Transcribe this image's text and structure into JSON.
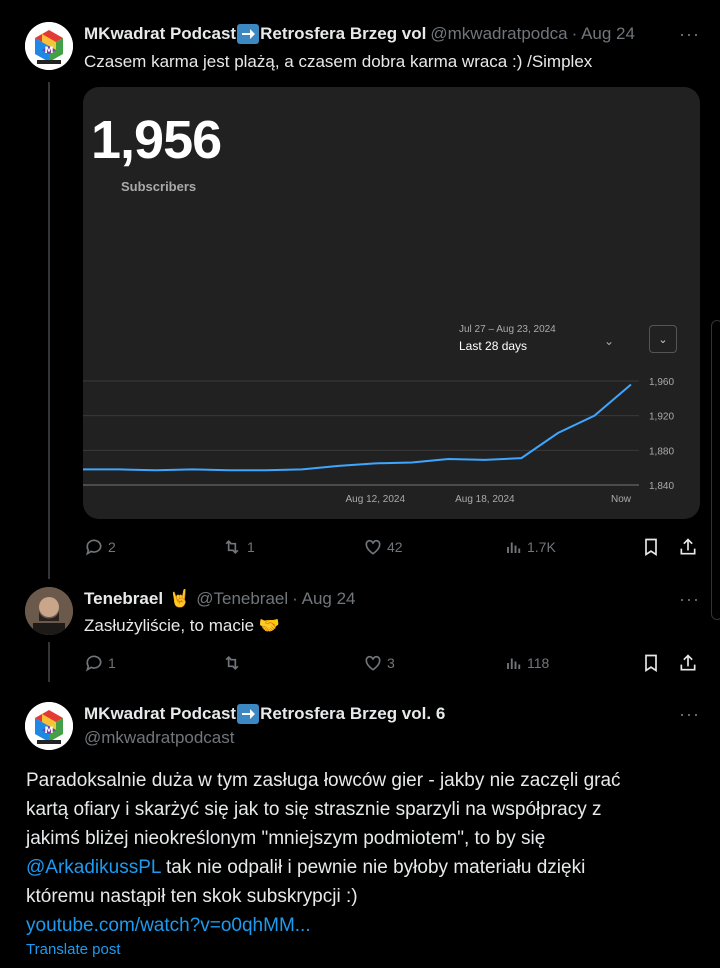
{
  "tweet1": {
    "name_part1": "MKwadrat Podcast",
    "name_part2": "Retrosfera Brzeg vol",
    "handle": "@mkwadratpodca",
    "time": "· Aug 24",
    "text": "Czasem karma jest plażą, a czasem dobra karma wraca :) /Simplex",
    "stats": {
      "replies": "2",
      "reposts": "1",
      "likes": "42",
      "views": "1.7K"
    }
  },
  "card": {
    "big_number": "1,956",
    "label": "Subscribers",
    "date_range": "Jul 27 – Aug 23, 2024",
    "period": "Last 28 days",
    "chevron": "⌄",
    "chevron_box": "⌄",
    "accent_color": "#3ea6ff"
  },
  "chart_data": {
    "type": "line",
    "x": [
      "Jul 27",
      "Jul 29",
      "Jul 31",
      "Aug 2",
      "Aug 4",
      "Aug 6",
      "Aug 8",
      "Aug 10",
      "Aug 12",
      "Aug 14",
      "Aug 16",
      "Aug 18",
      "Aug 20",
      "Aug 21",
      "Aug 22",
      "Aug 23"
    ],
    "values": [
      1858,
      1858,
      1857,
      1858,
      1857,
      1857,
      1858,
      1862,
      1865,
      1866,
      1870,
      1869,
      1871,
      1900,
      1920,
      1956
    ],
    "xticks": [
      "Aug 12, 2024",
      "Aug 18, 2024",
      "Now"
    ],
    "yticks": [
      "1,960",
      "1,920",
      "1,880",
      "1,840"
    ],
    "ylim": [
      1840,
      1960
    ],
    "grid": true
  },
  "tweet2": {
    "name": "Tenebrael",
    "emoji": "🤘",
    "handle": "@Tenebrael",
    "time": "· Aug 24",
    "text": "Zasłużyliście, to macie",
    "text_emoji": "🤝",
    "stats": {
      "replies": "1",
      "reposts": "",
      "likes": "3",
      "views": "118"
    }
  },
  "tweet3": {
    "name_part1": "MKwadrat Podcast",
    "name_part2": "Retrosfera Brzeg vol. 6",
    "handle": "@mkwadratpodcast",
    "line1": "Paradoksalnie duża w tym zasługa łowców gier - jakby nie zaczęli grać",
    "line2": "kartą ofiary i skarżyć się jak to się strasznie sparzyli na współpracy z",
    "line3": "jakimś bliżej nieokreślonym \"mniejszym podmiotem\", to by się",
    "mention": "@ArkadikussPL",
    "line4_rest": " tak nie odpalił i pewnie nie byłoby materiału dzięki",
    "line5": "któremu nastąpił ten skok subskrypcji :)",
    "link": "youtube.com/watch?v=o0qhMM...",
    "translate": "Translate post"
  },
  "more_label": "···"
}
